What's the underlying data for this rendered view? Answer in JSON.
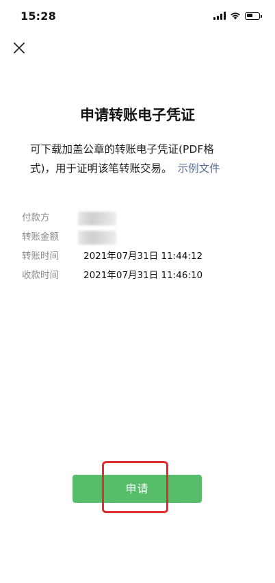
{
  "status_bar": {
    "time": "15:28",
    "battery_level": 0.5
  },
  "header": {
    "close_icon": "close-icon"
  },
  "main": {
    "title": "申请转账电子凭证",
    "description_line1": "可下载加盖公章的转账电子凭证(PDF格",
    "description_line2": "式)，用于证明该笔转账交易。",
    "sample_link": "示例文件"
  },
  "info": {
    "rows": [
      {
        "label": "付款方",
        "value": ""
      },
      {
        "label": "转账金额",
        "value": ""
      },
      {
        "label": "转账时间",
        "value": "2021年07月31日 11:44:12"
      },
      {
        "label": "收款时间",
        "value": "2021年07月31日 11:46:10"
      }
    ]
  },
  "actions": {
    "apply_label": "申请"
  },
  "colors": {
    "primary_green": "#57bd6a",
    "link_blue": "#576b95",
    "highlight_red": "#e02d2d"
  }
}
